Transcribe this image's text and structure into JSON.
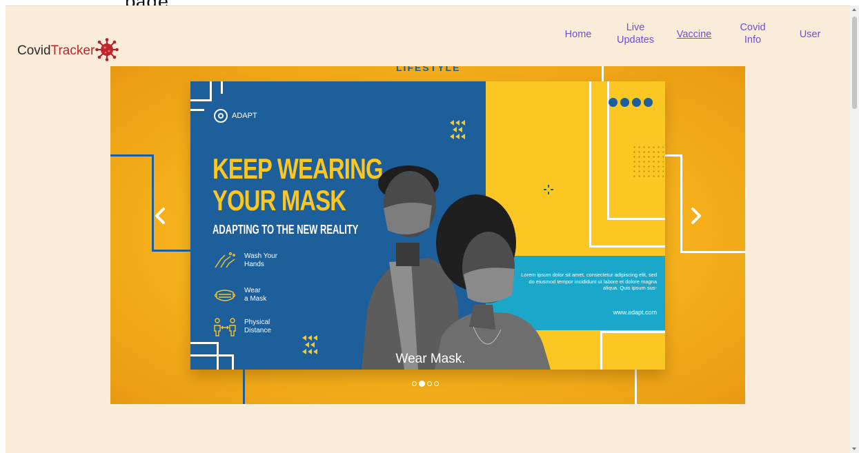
{
  "page_caption": "page",
  "brand": {
    "name_primary": "Covid",
    "name_accent": "Tracker"
  },
  "nav": [
    {
      "line1": "Home",
      "line2": ""
    },
    {
      "line1": "Live",
      "line2": "Updates"
    },
    {
      "line1": "Vaccine",
      "line2": "",
      "active": true
    },
    {
      "line1": "Covid",
      "line2": "Info"
    },
    {
      "line1": "User",
      "line2": ""
    }
  ],
  "carousel": {
    "top_text": "LIFESTYLE",
    "active_index": 1,
    "indicator_count": 4,
    "caption": "Wear Mask.",
    "slide": {
      "logo_text": "ADAPT",
      "headline_line1": "KEEP WEARING",
      "headline_line2": "YOUR MASK",
      "subline": "ADAPTING TO THE NEW REALITY",
      "tips": [
        {
          "line1": "Wash Your",
          "line2": "Hands",
          "icon": "hands-icon"
        },
        {
          "line1": "Wear",
          "line2": "a Mask",
          "icon": "mask-icon"
        },
        {
          "line1": "Physical",
          "line2": "Distance",
          "icon": "distance-icon"
        }
      ],
      "lorem": "Lorem ipsum dolor sit amet, consectetur adipiscing elit, sed do eiusmod tempor incididunt ut labore et dolore magna aliqua. Quis ipsum sus-",
      "website": "www.adapt.com"
    }
  },
  "colors": {
    "nav_link": "#6c4fd3",
    "brand_accent": "#c0252b",
    "page_bg": "#fbebd9",
    "slide_blue": "#1d5f9a",
    "slide_yellow": "#fcc623",
    "slide_cyan": "#1aa7c9"
  }
}
